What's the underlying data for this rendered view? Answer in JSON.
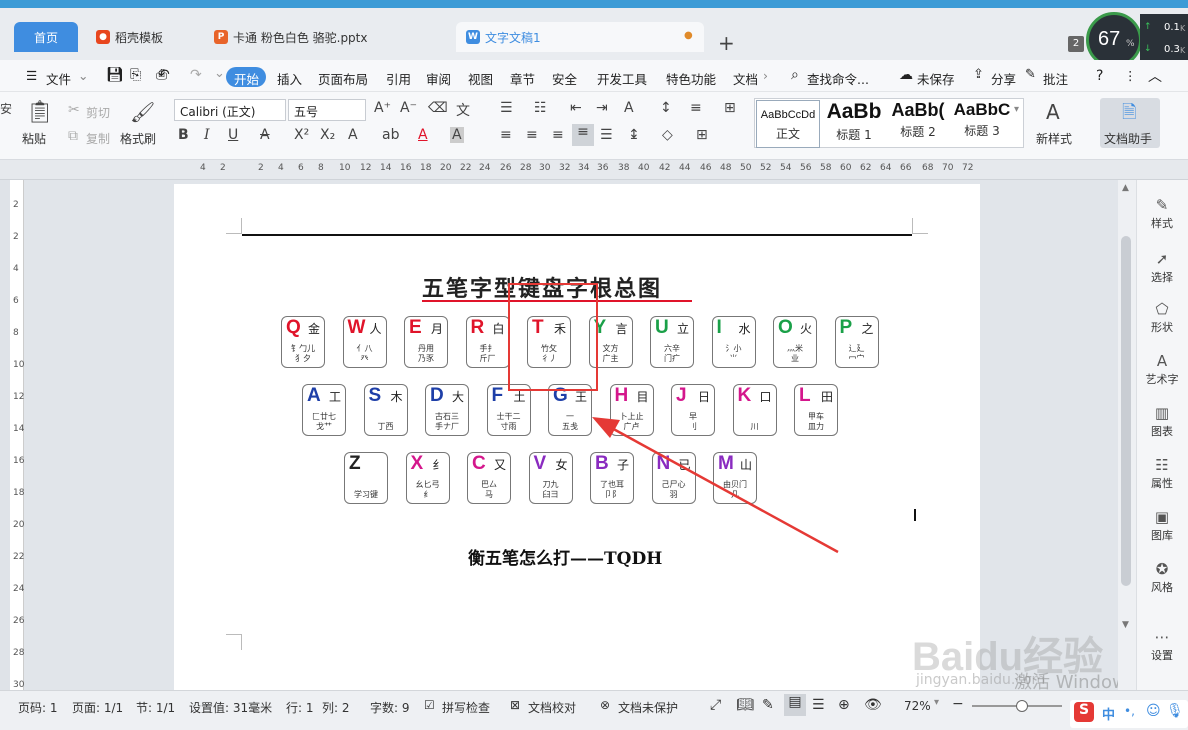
{
  "tabs": [
    {
      "label": "首页",
      "active": true
    },
    {
      "label": "稻壳模板",
      "icon": "docer-icon"
    },
    {
      "label": "卡通 粉色白色 骆驼.pptx",
      "icon": "ppt-icon"
    },
    {
      "label": "文字文稿1",
      "icon": "word-icon",
      "current": true
    }
  ],
  "tab_add": "+",
  "perf": {
    "badge": "2",
    "percent": "67",
    "unit": "%",
    "up": "0.1",
    "up_unit": "K",
    "down": "0.3",
    "down_unit": "K"
  },
  "menu": {
    "file": "文件",
    "items": [
      "开始",
      "插入",
      "页面布局",
      "引用",
      "审阅",
      "视图",
      "章节",
      "安全",
      "开发工具",
      "特色功能",
      "文档"
    ],
    "search": "查找命令...",
    "unsaved": "未保存",
    "share": "分享",
    "comment": "批注"
  },
  "ribbon": {
    "paste": "粘贴",
    "cut": "剪切",
    "copy": "复制",
    "format_painter": "格式刷",
    "font": "Calibri (正文)",
    "size": "五号",
    "styles": [
      {
        "preview": "AaBbCcDd",
        "label": "正文"
      },
      {
        "preview": "AaBb",
        "label": "标题 1"
      },
      {
        "preview": "AaBb(",
        "label": "标题 2"
      },
      {
        "preview": "AaBbC",
        "label": "标题 3"
      }
    ],
    "new_style": "新样式",
    "assistant": "文档助手"
  },
  "ruler_numbers": [
    "4",
    "2",
    "2",
    "4",
    "6",
    "8",
    "10",
    "12",
    "14",
    "16",
    "18",
    "20",
    "22",
    "24",
    "26",
    "28",
    "30",
    "32",
    "34",
    "36",
    "38",
    "40",
    "42",
    "44",
    "46",
    "48",
    "50",
    "52",
    "54",
    "56",
    "58",
    "60",
    "62",
    "64",
    "66",
    "68",
    "70",
    "72"
  ],
  "vruler_numbers": [
    "2",
    "2",
    "4",
    "6",
    "8",
    "10",
    "12",
    "14",
    "16",
    "18",
    "20",
    "22",
    "24",
    "26",
    "28",
    "30"
  ],
  "document": {
    "image_title": "五笔字型键盘字根总图",
    "caption": "衡五笔怎么打——TQDH",
    "keys": [
      [
        {
          "letter": "Q",
          "root": "金",
          "sub": "钅勹儿\n犭夕",
          "color": "#e0142a"
        },
        {
          "letter": "W",
          "root": "人",
          "sub": "亻八\n癶",
          "color": "#e0142a"
        },
        {
          "letter": "E",
          "root": "月",
          "sub": "丹用\n乃豕",
          "color": "#e0142a"
        },
        {
          "letter": "R",
          "root": "白",
          "sub": "手扌\n斤厂",
          "color": "#e0142a"
        },
        {
          "letter": "T",
          "root": "禾",
          "sub": "竹攵\n彳丿",
          "color": "#e0142a"
        },
        {
          "letter": "Y",
          "root": "言",
          "sub": "文方\n广主",
          "color": "#1aa048"
        },
        {
          "letter": "U",
          "root": "立",
          "sub": "六辛\n门疒",
          "color": "#1aa048"
        },
        {
          "letter": "I",
          "root": "水",
          "sub": "氵小\n⺌",
          "color": "#1aa048"
        },
        {
          "letter": "O",
          "root": "火",
          "sub": "灬米\n业",
          "color": "#1aa048"
        },
        {
          "letter": "P",
          "root": "之",
          "sub": "辶廴\n冖宀",
          "color": "#1aa048"
        }
      ],
      [
        {
          "letter": "A",
          "root": "工",
          "sub": "匚廿七\n戈艹",
          "color": "#1e3fa8"
        },
        {
          "letter": "S",
          "root": "木",
          "sub": "丁西",
          "color": "#1e3fa8"
        },
        {
          "letter": "D",
          "root": "大",
          "sub": "古石三\n手ナ厂",
          "color": "#1e3fa8"
        },
        {
          "letter": "F",
          "root": "土",
          "sub": "士干二\n寸雨",
          "color": "#1e3fa8"
        },
        {
          "letter": "G",
          "root": "王",
          "sub": "一\n五戋",
          "color": "#1e3fa8"
        },
        {
          "letter": "H",
          "root": "目",
          "sub": "卜上止\n广卢",
          "color": "#d4178c"
        },
        {
          "letter": "J",
          "root": "日",
          "sub": "早\n刂",
          "color": "#d4178c"
        },
        {
          "letter": "K",
          "root": "口",
          "sub": "川",
          "color": "#d4178c"
        },
        {
          "letter": "L",
          "root": "田",
          "sub": "甲车\n皿力",
          "color": "#d4178c"
        }
      ],
      [
        {
          "letter": "Z",
          "root": "",
          "sub": "学习键",
          "color": "#222"
        },
        {
          "letter": "X",
          "root": "纟",
          "sub": "幺匕弓\n纟",
          "color": "#d4178c"
        },
        {
          "letter": "C",
          "root": "又",
          "sub": "巴厶\n马",
          "color": "#d4178c"
        },
        {
          "letter": "V",
          "root": "女",
          "sub": "刀九\n臼彐",
          "color": "#8a2bc0"
        },
        {
          "letter": "B",
          "root": "子",
          "sub": "了也耳\n卩阝",
          "color": "#8a2bc0"
        },
        {
          "letter": "N",
          "root": "已",
          "sub": "己尸心\n羽",
          "color": "#8a2bc0"
        },
        {
          "letter": "M",
          "root": "山",
          "sub": "由贝门\n几",
          "color": "#8a2bc0"
        }
      ]
    ]
  },
  "sidepanel": [
    {
      "label": "样式",
      "icon": "pen-icon"
    },
    {
      "label": "选择",
      "icon": "cursor-icon"
    },
    {
      "label": "形状",
      "icon": "shape-icon"
    },
    {
      "label": "艺术字",
      "icon": "wordart-icon"
    },
    {
      "label": "图表",
      "icon": "chart-icon"
    },
    {
      "label": "属性",
      "icon": "properties-icon"
    },
    {
      "label": "图库",
      "icon": "image-icon"
    },
    {
      "label": "风格",
      "icon": "style-icon"
    },
    {
      "label": "设置",
      "icon": "settings-icon"
    }
  ],
  "status": {
    "page": "页码: 1",
    "pages": "页面: 1/1",
    "section": "节: 1/1",
    "setting": "设置值: 31毫米",
    "row": "行: 1",
    "col": "列: 2",
    "words": "字数: 9",
    "spell": "拼写检查",
    "proof": "文档校对",
    "protect": "文档未保护",
    "zoom": "72%",
    "ime": "中"
  },
  "watermark": {
    "brand": "Baidu经验",
    "url": "jingyan.baidu.com",
    "activate": "激活 Windows"
  }
}
